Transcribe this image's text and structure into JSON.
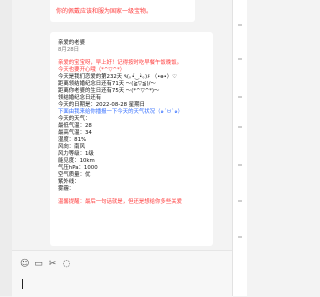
{
  "chat": {
    "top_message": "你的佩戴应该和服为国家一级宝物。",
    "message": {
      "title": "亲爱的老婆",
      "date": "8月28日",
      "lines": [
        "亲爱的宝宝呀，早上好！记得按时吃早餐午饭晚饭。",
        "今天也要开心哦（*^▽^*）",
        "今天是我们恋爱的第232天 ٩(｡•́‿•̀｡)۶ （•ө•）♡",
        "距离领结婚纪念日还有71天 ～(≧▽≦)/～",
        "距离你老婆的生日还有75天 ～(*^▽^*)～",
        "领结婚纪念日还有",
        "今天的日期是：2022-08-28 星期日",
        "下面由我来给你播报一下今天的天气状况（๑´ㅂ`๑）",
        "今天的天气：",
        "最低气温：28",
        "最高气温：34",
        "湿度：81%",
        "风向：南风",
        "风力等级：1级",
        "能见度：10km",
        "气压hPa：1000",
        "空气质量：优",
        "紫外线：",
        "雾霾：",
        "温馨提醒：最后一句话就是，但还是想给你多些关爱"
      ]
    }
  },
  "input": {
    "icons": [
      "emoji-icon",
      "folder-icon",
      "scissors-icon",
      "chat-bubble-icon"
    ]
  }
}
